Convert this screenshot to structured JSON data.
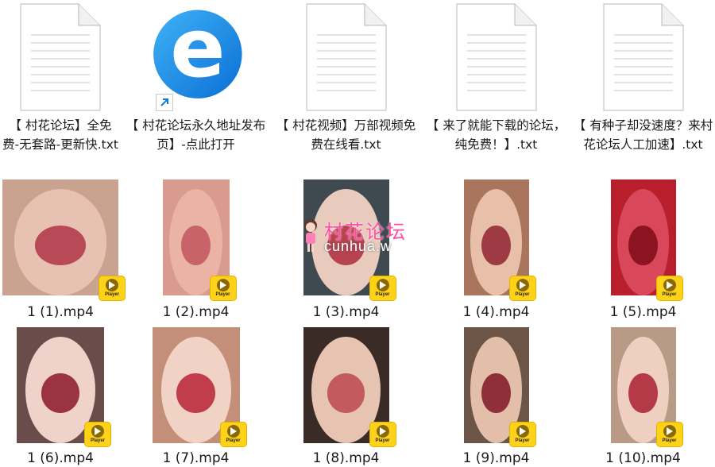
{
  "files": [
    {
      "kind": "txt",
      "label": "【 村花论坛】全免费-无套路-更新快.txt"
    },
    {
      "kind": "shortcut",
      "label": "【 村花论坛永久地址发布页】-点此打开"
    },
    {
      "kind": "txt",
      "label": "【 村花视频】万部视频免费在线看.txt"
    },
    {
      "kind": "txt",
      "label": "【 来了就能下载的论坛，纯免费！】.txt"
    },
    {
      "kind": "txt",
      "label": "【 有种子却没速度？来村花论坛人工加速】.txt"
    }
  ],
  "videos": [
    {
      "label": "1 (1).mp4",
      "bg": "#c9a38f",
      "face": "#e7c2b3",
      "mouth": "#b84a57",
      "w": 146
    },
    {
      "label": "1 (2).mp4",
      "bg": "#d99b8e",
      "face": "#eab3a4",
      "mouth": "#c9636a",
      "w": 84
    },
    {
      "label": "1 (3).mp4",
      "bg": "#3e4a4f",
      "face": "#e9cbbd",
      "mouth": "#b74350",
      "w": 108
    },
    {
      "label": "1 (4).mp4",
      "bg": "#a9765d",
      "face": "#e8bfa8",
      "mouth": "#9d3a44",
      "w": 82
    },
    {
      "label": "1 (5).mp4",
      "bg": "#b81e2c",
      "face": "#d8485a",
      "mouth": "#8c1422",
      "w": 82
    },
    {
      "label": "1 (6).mp4",
      "bg": "#6a4d4a",
      "face": "#efd2c9",
      "mouth": "#9a3442",
      "w": 110
    },
    {
      "label": "1 (7).mp4",
      "bg": "#c48f79",
      "face": "#f1d3c6",
      "mouth": "#c23d4c",
      "w": 110
    },
    {
      "label": "1 (8).mp4",
      "bg": "#3b2b27",
      "face": "#e7c3b2",
      "mouth": "#c25a5e",
      "w": 108
    },
    {
      "label": "1 (9).mp4",
      "bg": "#6c5446",
      "face": "#e3bea9",
      "mouth": "#8e2f39",
      "w": 82
    },
    {
      "label": "1 (10).mp4",
      "bg": "#b89a86",
      "face": "#efcfbf",
      "mouth": "#b53a48",
      "w": 82
    }
  ],
  "badge_text": "Player",
  "watermark": {
    "title": "村花论坛",
    "url": "cunhua.w"
  },
  "colors": {
    "accent": "#0a8be0",
    "badge": "#ffd21a"
  }
}
